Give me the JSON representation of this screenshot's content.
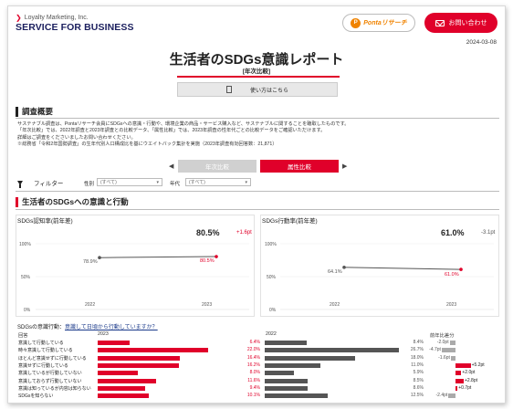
{
  "header": {
    "logo_top": "Loyalty Marketing, Inc.",
    "logo_main": "SERVICE FOR BUSINESS",
    "ponta_research": "Pontaリサーチ",
    "contact": "お問い合わせ",
    "date": "2024-03-08"
  },
  "report": {
    "title": "生活者のSDGs意識レポート",
    "subtitle": "[年次比較]",
    "usage_button": "使い方はこちら"
  },
  "overview": {
    "heading": "調査概要",
    "lines": [
      "サステナブル調査は、Pontaリサーチ会員にSDGsへの意識・行動や、環境企業の商品・サービス購入など、サステナブルに関することを聴取したものです。",
      "「年次比較」では、2022年調査と2023年調査との比較データ、「属性比較」では、2023年調査の性年代ごとの比較データをご確認いただけます。",
      "詳細はご調査をくださいましたお問い合わせください。",
      "※総務省「令和2年国勢調査」の生年代別人口構成比を基にウエイトバック集計を実施（2023年調査有効回答数：21,871）"
    ]
  },
  "toggle": {
    "annual": "年次比較",
    "attribute": "属性比較"
  },
  "filter": {
    "label": "フィルター",
    "gender_label": "性別",
    "gender_value": "(すべて)",
    "age_label": "年代",
    "age_value": "(すべて)"
  },
  "section2": {
    "heading": "生活者のSDGsへの意識と行動"
  },
  "charts": {
    "awareness": {
      "title": "SDGs認知率(前年差)",
      "value": "80.5%",
      "delta": "+1.6pt",
      "y_ticks": [
        "100%",
        "50%",
        "0%"
      ],
      "x_labels": [
        "2022",
        "2023"
      ],
      "labels": [
        "78.9%",
        "80.5%"
      ]
    },
    "action": {
      "title": "SDGs行動率(前年差)",
      "value": "61.0%",
      "delta": "-3.1pt",
      "y_ticks": [
        "100%",
        "50%",
        "0%"
      ],
      "x_labels": [
        "2022",
        "2023"
      ],
      "labels": [
        "64.1%",
        "61.0%"
      ]
    }
  },
  "chart_data": [
    {
      "type": "line",
      "title": "SDGs認知率(前年差)",
      "x": [
        "2022",
        "2023"
      ],
      "values": [
        78.9,
        80.5
      ],
      "ylim": [
        0,
        100
      ]
    },
    {
      "type": "line",
      "title": "SDGs行動率(前年差)",
      "x": [
        "2022",
        "2023"
      ],
      "values": [
        64.1,
        61.0
      ],
      "ylim": [
        0,
        100
      ]
    },
    {
      "type": "bar",
      "title": "SDGsの意識行動：意識して日頃から行動していますか？",
      "categories": [
        "意識して行動している",
        "時々意識して行動している",
        "ほとんど意識せずに行動している",
        "意識せずに行動している",
        "意識しているが行動していない",
        "意識しておらず行動していない",
        "意識は知っているが内容は知らない",
        "SDGsを知らない"
      ],
      "series": [
        {
          "name": "2023",
          "values": [
            6.4,
            22.0,
            16.4,
            16.2,
            8.0,
            11.6,
            9.4,
            10.1
          ]
        },
        {
          "name": "2022",
          "values": [
            8.4,
            26.7,
            18.0,
            11.0,
            5.9,
            8.5,
            8.6,
            12.5
          ]
        },
        {
          "name": "前年差",
          "values": [
            -2.0,
            -4.7,
            -1.6,
            5.2,
            2.0,
            2.8,
            0.7,
            -2.4
          ]
        }
      ]
    }
  ],
  "question": {
    "prefix": "SDGsの意識行動：",
    "link": "意識して日頃から行動していますか？"
  },
  "table": {
    "col_answer": "回答",
    "col_2023": "2023",
    "col_2022": "2022",
    "col_diff": "前年比差分",
    "rows": [
      {
        "label": "意識して行動している",
        "v2023": "6.4%",
        "v2022": "8.4%",
        "diff": "-2.0pt"
      },
      {
        "label": "時々意識して行動している",
        "v2023": "22.0%",
        "v2022": "26.7%",
        "diff": "-4.7pt"
      },
      {
        "label": "ほとんど意識せずに行動している",
        "v2023": "16.4%",
        "v2022": "18.0%",
        "diff": "-1.6pt"
      },
      {
        "label": "意識せずに行動している",
        "v2023": "16.2%",
        "v2022": "11.0%",
        "diff": "+5.2pt"
      },
      {
        "label": "意識しているが行動していない",
        "v2023": "8.0%",
        "v2022": "5.9%",
        "diff": "+2.0pt"
      },
      {
        "label": "意識しておらず行動していない",
        "v2023": "11.6%",
        "v2022": "8.5%",
        "diff": "+2.8pt"
      },
      {
        "label": "意識は知っているが内容は知らない",
        "v2023": "9.4%",
        "v2022": "8.6%",
        "diff": "+0.7pt"
      },
      {
        "label": "SDGsを知らない",
        "v2023": "10.1%",
        "v2022": "12.5%",
        "diff": "-2.4pt"
      }
    ]
  },
  "colors": {
    "accent": "#e0002a",
    "navy": "#1b1f5e",
    "gray_bar": "#555555"
  }
}
